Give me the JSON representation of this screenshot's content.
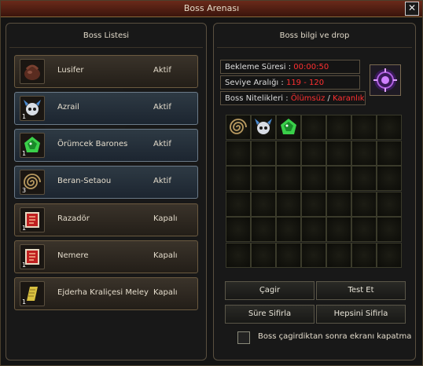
{
  "window": {
    "title": "Boss Arenası",
    "close_label": "✕"
  },
  "left_panel": {
    "heading": "Boss Listesi",
    "bosses": [
      {
        "name": "Lusifer",
        "status": "Aktif",
        "icon": "leather-bag-icon",
        "count": ""
      },
      {
        "name": "Azrail",
        "status": "Aktif",
        "icon": "horned-skull-helmet-icon",
        "count": "1"
      },
      {
        "name": "Örümcek Barones",
        "status": "Aktif",
        "icon": "green-spider-gem-icon",
        "count": "1"
      },
      {
        "name": "Beran-Setaou",
        "status": "Aktif",
        "icon": "spiral-coil-icon",
        "count": "3"
      },
      {
        "name": "Razadör",
        "status": "Kapalı",
        "icon": "red-scroll-icon",
        "count": "1"
      },
      {
        "name": "Nemere",
        "status": "Kapalı",
        "icon": "red-scroll-icon",
        "count": "1"
      },
      {
        "name": "Ejderha Kraliçesi Meley",
        "status": "Kapalı",
        "icon": "yellow-scroll-icon",
        "count": "1"
      }
    ]
  },
  "right_panel": {
    "heading": "Boss bilgi ve drop",
    "wait_label": "Bekleme Süresi :",
    "wait_value": "00:00:50",
    "level_label": "Seviye Aralığı :",
    "level_value": "119 - 120",
    "traits_label": "Boss Nitelikleri :",
    "trait_1": "Ölümsüz",
    "trait_sep": "/",
    "trait_2": "Karanlık",
    "portrait_icon": "purple-rune-icon",
    "drops": [
      "spiral-coil-icon",
      "horned-skull-helmet-icon",
      "green-spider-gem-icon"
    ],
    "buttons": {
      "summon": "Çagir",
      "test": "Test Et",
      "reset_time": "Süre Sifirla",
      "reset_all": "Hepsini Sifirla"
    },
    "checkbox_label": "Boss çagirdiktan sonra ekranı kapatma"
  },
  "colors": {
    "active_row": "#2e3a44",
    "normal_row": "#3a332a",
    "warning": "#ff3030"
  }
}
